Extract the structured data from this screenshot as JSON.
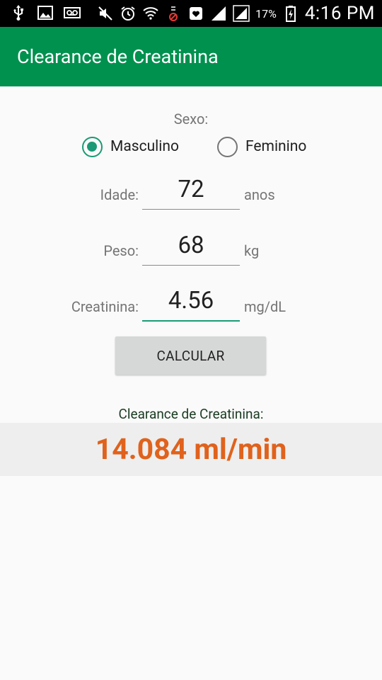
{
  "status_bar": {
    "battery_percent": "17%",
    "time": "4:16 PM"
  },
  "app_bar": {
    "title": "Clearance de Creatinina",
    "color": "#00914f"
  },
  "form": {
    "sex_label": "Sexo:",
    "options": [
      {
        "label": "Masculino",
        "checked": true
      },
      {
        "label": "Feminino",
        "checked": false
      }
    ],
    "fields": [
      {
        "label": "Idade:",
        "value": "72",
        "unit": "anos"
      },
      {
        "label": "Peso:",
        "value": "68",
        "unit": "kg"
      },
      {
        "label": "Creatinina:",
        "value": "4.56",
        "unit": "mg/dL"
      }
    ],
    "accent_color": "#1a9a76"
  },
  "calculate_button": {
    "label": "CALCULAR"
  },
  "result": {
    "label": "Clearance de Creatinina:",
    "value": "14.084 ml/min",
    "color": "#e0621c"
  }
}
